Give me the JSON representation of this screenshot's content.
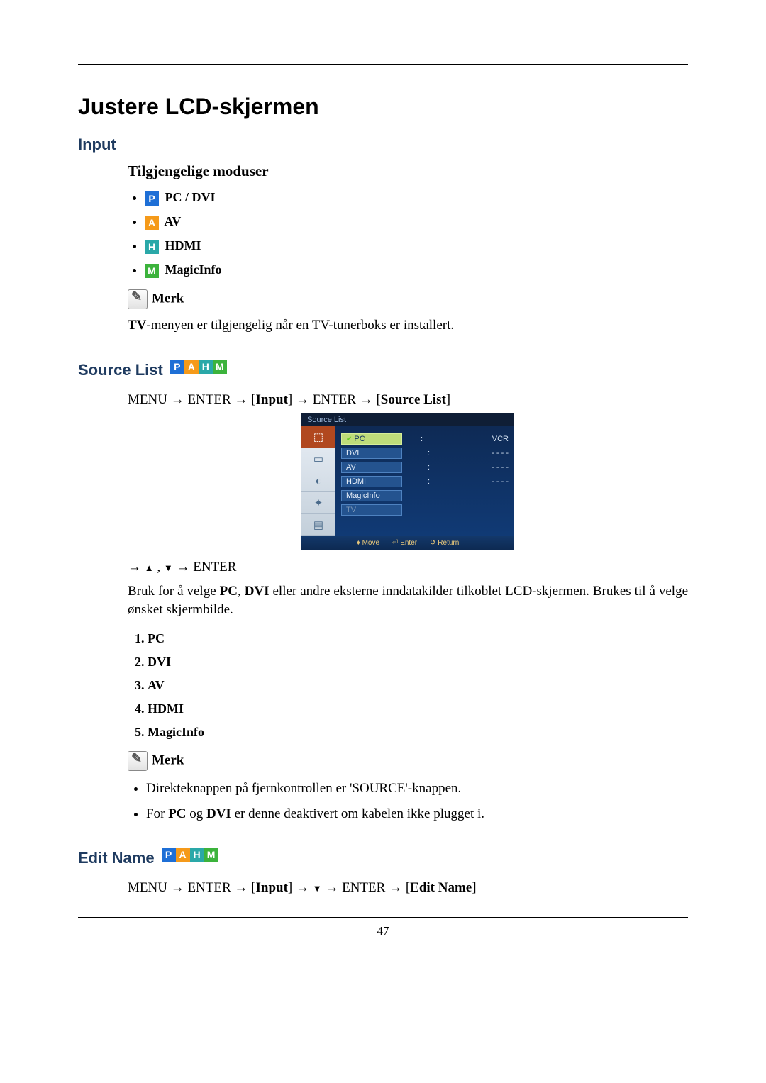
{
  "page_number": "47",
  "title": "Justere LCD-skjermen",
  "section_input": "Input",
  "subhead_modes": "Tilgjengelige moduser",
  "modes": {
    "pc": "PC / DVI",
    "av": "AV",
    "hdmi": "HDMI",
    "magic": "MagicInfo"
  },
  "note_label": "Merk",
  "tv_note_prefix": "TV",
  "tv_note_rest": "-menyen er tilgjengelig når en TV-tunerboks er installert.",
  "section_source": "Source List",
  "path_source": {
    "p1": "MENU → ENTER → [",
    "b1": "Input",
    "p2": "] → ENTER → [",
    "b2": "Source List",
    "p3": "]"
  },
  "osd": {
    "title": "Source List",
    "rows": [
      {
        "label": "PC",
        "right": "VCR",
        "selected": true
      },
      {
        "label": "DVI",
        "right": "- - - -"
      },
      {
        "label": "AV",
        "right": "- - - -"
      },
      {
        "label": "HDMI",
        "right": "- - - -"
      },
      {
        "label": "MagicInfo",
        "right": ""
      },
      {
        "label": "TV",
        "right": "",
        "dim": true
      }
    ],
    "footer": {
      "move": "Move",
      "enter": "Enter",
      "return": "Return"
    }
  },
  "nav_post": " → ENTER",
  "source_para_before_pc": "Bruk for å velge ",
  "source_para_pc": "PC",
  "source_para_mid1": ", ",
  "source_para_dvi": "DVI",
  "source_para_after": " eller andre eksterne inndatakilder tilkoblet LCD-skjermen. Brukes til å velge ønsket skjermbilde.",
  "numbered": [
    "PC",
    "DVI",
    "AV",
    "HDMI",
    "MagicInfo"
  ],
  "note2_items": {
    "a": "Direkteknappen på fjernkontrollen er 'SOURCE'-knappen.",
    "b_pre": "For ",
    "b_pc": "PC",
    "b_and": " og ",
    "b_dvi": "DVI",
    "b_rest": " er denne deaktivert om kabelen ikke plugget i."
  },
  "section_edit": "Edit Name",
  "path_edit": {
    "p1": "MENU → ENTER → [",
    "b1": "Input",
    "p2": "] → ",
    "p3": " → ENTER → [",
    "b2": "Edit Name",
    "p4": "]"
  }
}
